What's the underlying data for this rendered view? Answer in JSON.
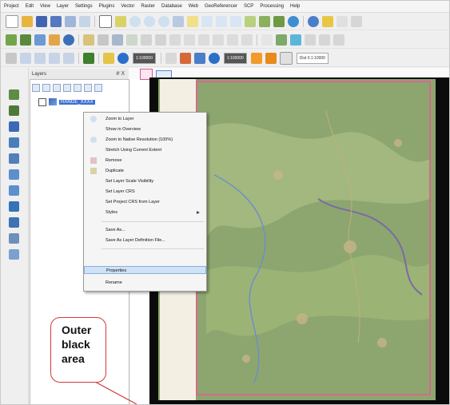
{
  "menu": [
    "Project",
    "Edit",
    "View",
    "Layer",
    "Settings",
    "Plugins",
    "Vector",
    "Raster",
    "Database",
    "Web",
    "GeoReferencer",
    "SCP",
    "Processing",
    "Help"
  ],
  "layers_panel": {
    "title": "Layers",
    "title_controls": "# X",
    "layer_name": "RANGE_XXXX"
  },
  "context_menu": {
    "items": [
      "Zoom to Layer",
      "Show in Overview",
      "Zoom to Native Resolution (100%)",
      "Stretch Using Current Extent",
      "Remove",
      "Duplicate",
      "Set Layer Scale Visibility",
      "Set Layer CRS",
      "Set Project CRS from Layer",
      "Styles",
      "Save As...",
      "Save As Layer Definition File...",
      "Properties",
      "Rename"
    ],
    "selected": "Properties"
  },
  "toolbar": {
    "zoom_box": "1:100000",
    "coord_box": "Dist 0.1:10000"
  },
  "callout": {
    "lines": [
      "Outer",
      "black",
      "area"
    ],
    "border_color": "#d43a3a"
  },
  "colors": {
    "map_green": "#8aa46a",
    "map_border": "#d46a8f",
    "selection": "#cfe2f6"
  }
}
